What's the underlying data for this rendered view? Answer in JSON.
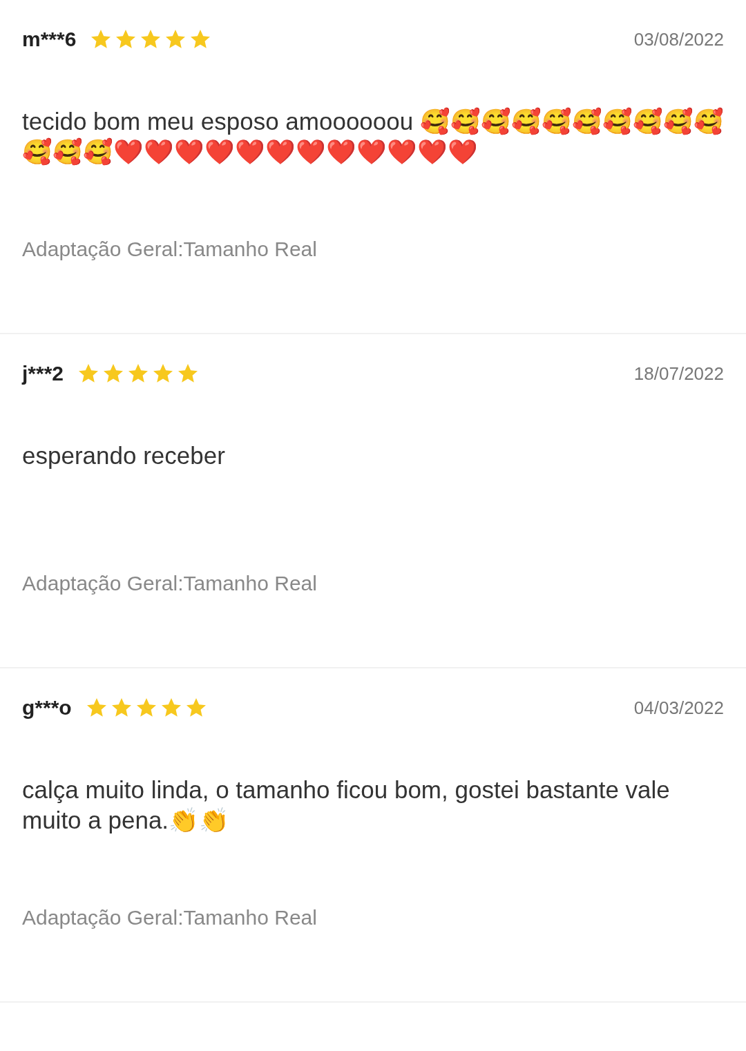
{
  "reviews": [
    {
      "user": "m***6",
      "stars": 5,
      "date": "03/08/2022",
      "comment": "tecido bom meu esposo amoooooou 🥰🥰🥰🥰🥰🥰🥰🥰🥰🥰🥰🥰🥰❤️❤️❤️❤️❤️❤️❤️❤️❤️❤️❤️❤️",
      "fit": "Adaptação Geral:Tamanho Real"
    },
    {
      "user": "j***2",
      "stars": 5,
      "date": "18/07/2022",
      "comment": "esperando receber",
      "fit": "Adaptação Geral:Tamanho Real"
    },
    {
      "user": "g***o",
      "stars": 5,
      "date": "04/03/2022",
      "comment": "calça muito linda, o tamanho ficou bom, gostei bastante vale muito a pena.👏👏",
      "fit": "Adaptação Geral:Tamanho Real"
    }
  ]
}
